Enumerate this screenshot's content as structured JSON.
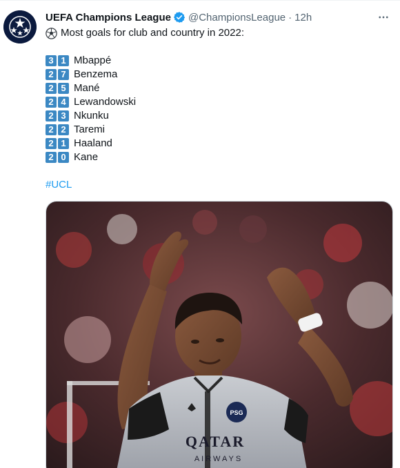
{
  "tweet": {
    "display_name": "UEFA Champions League",
    "handle": "@ChampionsLeague",
    "separator": "·",
    "time": "12h",
    "intro": "Most goals for club and country in 2022:",
    "ranking": [
      {
        "goals": [
          "3",
          "1"
        ],
        "player": "Mbappé"
      },
      {
        "goals": [
          "2",
          "7"
        ],
        "player": "Benzema"
      },
      {
        "goals": [
          "2",
          "5"
        ],
        "player": "Mané"
      },
      {
        "goals": [
          "2",
          "4"
        ],
        "player": "Lewandowski"
      },
      {
        "goals": [
          "2",
          "3"
        ],
        "player": "Nkunku"
      },
      {
        "goals": [
          "2",
          "2"
        ],
        "player": "Taremi"
      },
      {
        "goals": [
          "2",
          "1"
        ],
        "player": "Haaland"
      },
      {
        "goals": [
          "2",
          "0"
        ],
        "player": "Kane"
      }
    ],
    "hashtag": "#UCL",
    "media": {
      "shirt_sponsor_line1": "QATAR",
      "shirt_sponsor_line2": "AIRWAYS",
      "crest_text": "PSG"
    }
  },
  "colors": {
    "accent": "#1d9bf0",
    "keycap": "#3b88c3",
    "secondary_text": "#536471"
  },
  "icons": {
    "avatar": "ucl-starball-icon",
    "verified": "verified-badge-icon",
    "more": "more-dots-icon",
    "intro": "soccer-ball-icon"
  }
}
